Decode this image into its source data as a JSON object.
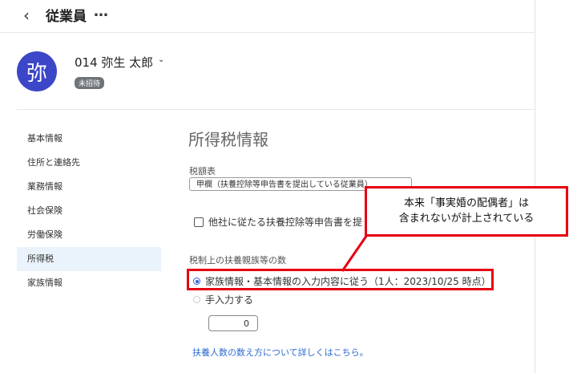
{
  "header": {
    "back_glyph": "‹",
    "title": "従業員",
    "more_glyph": "…"
  },
  "employee": {
    "avatar_char": "弥",
    "name": "014 弥生 太郎",
    "chevron": "⌄",
    "status": "未招待"
  },
  "sidebar": {
    "items": [
      {
        "label": "基本情報"
      },
      {
        "label": "住所と連絡先"
      },
      {
        "label": "業務情報"
      },
      {
        "label": "社会保険"
      },
      {
        "label": "労働保険"
      },
      {
        "label": "所得税",
        "active": true
      },
      {
        "label": "家族情報"
      }
    ]
  },
  "main": {
    "section_title": "所得税情報",
    "tax_table_label": "税額表",
    "tax_table_value": "甲欄（扶養控除等申告書を提出している従業員）",
    "other_company_checkbox": "他社に従たる扶養控除等申告書を提",
    "dependents_label": "税制上の扶養親族等の数",
    "option_family": "家族情報・基本情報の入力内容に従う（1人：2023/10/25 時点）",
    "option_manual": "手入力する",
    "manual_value": "0",
    "help_link": "扶養人数の数え方について詳しくはこちら。"
  },
  "annotation": {
    "line1": "本来「事実婚の配偶者」は",
    "line2": "含まれないが計上されている",
    "color": "#e60012"
  }
}
